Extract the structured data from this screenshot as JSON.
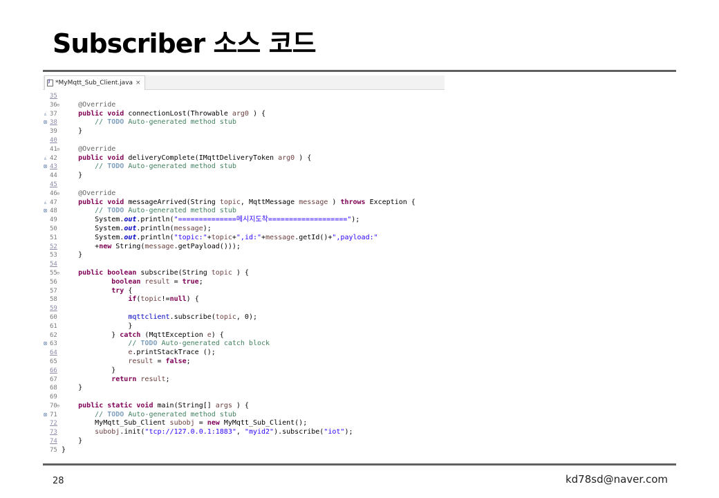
{
  "slide": {
    "title": "Subscriber 소스 코드",
    "page_number": "28",
    "author_email": "kd78sd@naver.com"
  },
  "editor": {
    "tab_label": "*MyMqtt_Sub_Client.java",
    "tab_close": "×",
    "lines": [
      {
        "n": "35",
        "u": true,
        "t": []
      },
      {
        "n": "36",
        "f": "⊖",
        "t": [
          [
            "an",
            "    @Override"
          ]
        ]
      },
      {
        "n": "37",
        "m": "▵",
        "t": [
          [
            "",
            "    "
          ],
          [
            "kw",
            "public void"
          ],
          [
            "",
            " connectionLost(Throwable "
          ],
          [
            "pv",
            "arg0"
          ],
          [
            "",
            " ) {"
          ]
        ]
      },
      {
        "n": "38",
        "m": "⊠",
        "u": true,
        "t": [
          [
            "cm",
            "        // "
          ],
          [
            "td",
            "TODO"
          ],
          [
            "cm",
            " Auto-generated method stub"
          ]
        ]
      },
      {
        "n": "39",
        "t": [
          [
            "",
            "    }"
          ]
        ]
      },
      {
        "n": "40",
        "u": true,
        "t": []
      },
      {
        "n": "41",
        "f": "⊖",
        "t": [
          [
            "an",
            "    @Override"
          ]
        ]
      },
      {
        "n": "42",
        "m": "▵",
        "t": [
          [
            "",
            "    "
          ],
          [
            "kw",
            "public void"
          ],
          [
            "",
            " deliveryComplete(IMqttDeliveryToken "
          ],
          [
            "pv",
            "arg0"
          ],
          [
            "",
            " ) {"
          ]
        ]
      },
      {
        "n": "43",
        "m": "⊠",
        "u": true,
        "t": [
          [
            "cm",
            "        // "
          ],
          [
            "td",
            "TODO"
          ],
          [
            "cm",
            " Auto-generated method stub"
          ]
        ]
      },
      {
        "n": "44",
        "t": [
          [
            "",
            "    }"
          ]
        ]
      },
      {
        "n": "45",
        "u": true,
        "t": []
      },
      {
        "n": "46",
        "f": "⊖",
        "t": [
          [
            "an",
            "    @Override"
          ]
        ]
      },
      {
        "n": "47",
        "m": "▵",
        "t": [
          [
            "",
            "    "
          ],
          [
            "kw",
            "public void"
          ],
          [
            "",
            " messageArrived(String "
          ],
          [
            "pv",
            "topic"
          ],
          [
            "",
            ", MqttMessage "
          ],
          [
            "pv",
            "message"
          ],
          [
            "",
            " ) "
          ],
          [
            "kw",
            "throws"
          ],
          [
            "",
            " Exception {"
          ]
        ]
      },
      {
        "n": "48",
        "m": "⊠",
        "t": [
          [
            "cm",
            "        // "
          ],
          [
            "td",
            "TODO"
          ],
          [
            "cm",
            " Auto-generated method stub"
          ]
        ]
      },
      {
        "n": "49",
        "t": [
          [
            "",
            "        System."
          ],
          [
            "sf",
            "out"
          ],
          [
            "",
            ".println("
          ],
          [
            "st",
            "\"==============메시지도착===================\""
          ],
          [
            "",
            ");"
          ]
        ]
      },
      {
        "n": "50",
        "t": [
          [
            "",
            "        System."
          ],
          [
            "sf",
            "out"
          ],
          [
            "",
            ".println("
          ],
          [
            "pv",
            "message"
          ],
          [
            "",
            ");"
          ]
        ]
      },
      {
        "n": "51",
        "t": [
          [
            "",
            "        System."
          ],
          [
            "sf",
            "out"
          ],
          [
            "",
            ".println("
          ],
          [
            "st",
            "\"topic:\""
          ],
          [
            "",
            "+"
          ],
          [
            "pv",
            "topic"
          ],
          [
            "",
            "+"
          ],
          [
            "st",
            "\",id:\""
          ],
          [
            "",
            "+"
          ],
          [
            "pv",
            "message"
          ],
          [
            "",
            ".getId()+"
          ],
          [
            "st",
            "\",payload:\""
          ]
        ]
      },
      {
        "n": "52",
        "u": true,
        "t": [
          [
            "",
            "        +"
          ],
          [
            "kw",
            "new"
          ],
          [
            "",
            " String("
          ],
          [
            "pv",
            "message"
          ],
          [
            "",
            ".getPayload()));"
          ]
        ]
      },
      {
        "n": "53",
        "t": [
          [
            "",
            "    }"
          ]
        ]
      },
      {
        "n": "54",
        "u": true,
        "t": []
      },
      {
        "n": "55",
        "f": "⊖",
        "t": [
          [
            "",
            "    "
          ],
          [
            "kw",
            "public boolean"
          ],
          [
            "",
            " subscribe(String "
          ],
          [
            "pv",
            "topic"
          ],
          [
            "",
            " ) {"
          ]
        ]
      },
      {
        "n": "56",
        "t": [
          [
            "",
            "            "
          ],
          [
            "kw",
            "boolean"
          ],
          [
            "",
            " "
          ],
          [
            "pv",
            "result"
          ],
          [
            "",
            " = "
          ],
          [
            "kw",
            "true"
          ],
          [
            "",
            ";"
          ]
        ]
      },
      {
        "n": "57",
        "t": [
          [
            "",
            "            "
          ],
          [
            "kw",
            "try"
          ],
          [
            "",
            " {"
          ]
        ]
      },
      {
        "n": "58",
        "t": [
          [
            "",
            "                "
          ],
          [
            "kw",
            "if"
          ],
          [
            "",
            "("
          ],
          [
            "pv",
            "topic"
          ],
          [
            "",
            "!="
          ],
          [
            "kw",
            "null"
          ],
          [
            "",
            ") {"
          ]
        ]
      },
      {
        "n": "59",
        "u": true,
        "t": []
      },
      {
        "n": "60",
        "t": [
          [
            "",
            "                "
          ],
          [
            "fd",
            "mqttclient"
          ],
          [
            "",
            ".subscribe("
          ],
          [
            "pv",
            "topic"
          ],
          [
            "",
            ", 0);"
          ]
        ]
      },
      {
        "n": "61",
        "t": [
          [
            "",
            "                }"
          ]
        ]
      },
      {
        "n": "62",
        "t": [
          [
            "",
            "            } "
          ],
          [
            "kw",
            "catch"
          ],
          [
            "",
            " (MqttException "
          ],
          [
            "pv",
            "e"
          ],
          [
            "",
            ") {"
          ]
        ]
      },
      {
        "n": "63",
        "m": "⊠",
        "t": [
          [
            "cm",
            "                // "
          ],
          [
            "td",
            "TODO"
          ],
          [
            "cm",
            " Auto-generated catch block"
          ]
        ]
      },
      {
        "n": "64",
        "u": true,
        "t": [
          [
            "",
            "                "
          ],
          [
            "pv",
            "e"
          ],
          [
            "",
            ".printStackTrace ();"
          ]
        ]
      },
      {
        "n": "65",
        "t": [
          [
            "",
            "                "
          ],
          [
            "pv",
            "result"
          ],
          [
            "",
            " = "
          ],
          [
            "kw",
            "false"
          ],
          [
            "",
            ";"
          ]
        ]
      },
      {
        "n": "66",
        "u": true,
        "t": [
          [
            "",
            "            }"
          ]
        ]
      },
      {
        "n": "67",
        "t": [
          [
            "",
            "            "
          ],
          [
            "kw",
            "return"
          ],
          [
            "",
            " "
          ],
          [
            "pv",
            "result"
          ],
          [
            "",
            ";"
          ]
        ]
      },
      {
        "n": "68",
        "t": [
          [
            "",
            "    }"
          ]
        ]
      },
      {
        "n": "69",
        "t": []
      },
      {
        "n": "70",
        "f": "⊖",
        "t": [
          [
            "",
            "    "
          ],
          [
            "kw",
            "public static void"
          ],
          [
            "",
            " main(String[] "
          ],
          [
            "pv",
            "args"
          ],
          [
            "",
            " ) {"
          ]
        ]
      },
      {
        "n": "71",
        "m": "⊠",
        "t": [
          [
            "cm",
            "        // "
          ],
          [
            "td",
            "TODO"
          ],
          [
            "cm",
            " Auto-generated method stub"
          ]
        ]
      },
      {
        "n": "72",
        "u": true,
        "t": [
          [
            "",
            "        MyMqtt_Sub_Client "
          ],
          [
            "pv",
            "subobj"
          ],
          [
            "",
            " = "
          ],
          [
            "kw",
            "new"
          ],
          [
            "",
            " MyMqtt_Sub_Client();"
          ]
        ]
      },
      {
        "n": "73",
        "u": true,
        "t": [
          [
            "",
            "        "
          ],
          [
            "pv",
            "subobj"
          ],
          [
            "",
            ".init("
          ],
          [
            "st",
            "\"tcp://127.0.0.1:1883\""
          ],
          [
            "",
            ", "
          ],
          [
            "st",
            "\"myid2\""
          ],
          [
            "",
            ").subscribe("
          ],
          [
            "st",
            "\"iot\""
          ],
          [
            "",
            ");"
          ]
        ]
      },
      {
        "n": "74",
        "u": true,
        "t": [
          [
            "",
            "    }"
          ]
        ]
      },
      {
        "n": "75",
        "t": [
          [
            "",
            "}"
          ]
        ]
      }
    ]
  }
}
